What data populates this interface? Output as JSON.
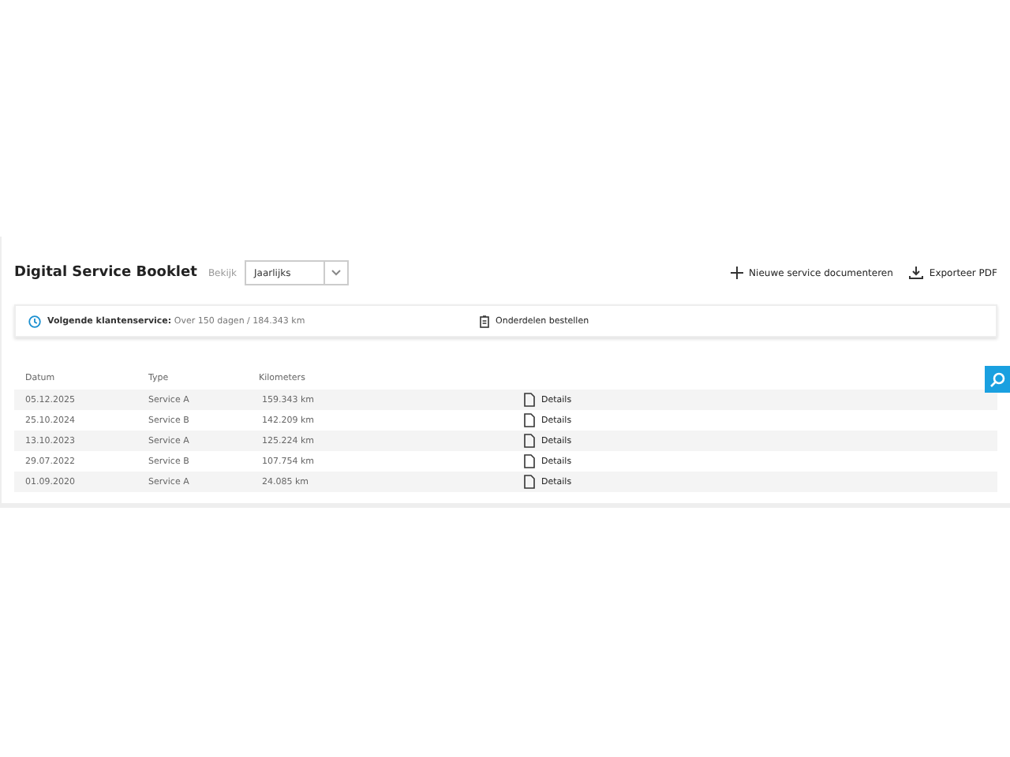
{
  "header": {
    "title": "Digital Service Booklet",
    "view_label": "Bekijk",
    "view_select": {
      "value": "Jaarlijks"
    },
    "actions": [
      {
        "kind": "add",
        "label": "Nieuwe service documenteren"
      },
      {
        "kind": "download",
        "label": "Exporteer PDF"
      }
    ]
  },
  "info_bar": {
    "next_label": "Volgende klantenservice:",
    "next_value": "Over 150 dagen / 184.343 km",
    "parts_link": "Onderdelen bestellen"
  },
  "table": {
    "columns": [
      "Datum",
      "Type",
      "Kilometers"
    ],
    "rows": [
      {
        "date": "05.12.2025",
        "type": "Service A",
        "km": "159.343 km",
        "action": "Details"
      },
      {
        "date": "25.10.2024",
        "type": "Service B",
        "km": "142.209 km",
        "action": "Details"
      },
      {
        "date": "13.10.2023",
        "type": "Service A",
        "km": "125.224 km",
        "action": "Details"
      },
      {
        "date": "29.07.2022",
        "type": "Service B",
        "km": "107.754 km",
        "action": "Details"
      },
      {
        "date": "01.09.2020",
        "type": "Service A",
        "km": "24.085 km",
        "action": "Details"
      }
    ]
  }
}
